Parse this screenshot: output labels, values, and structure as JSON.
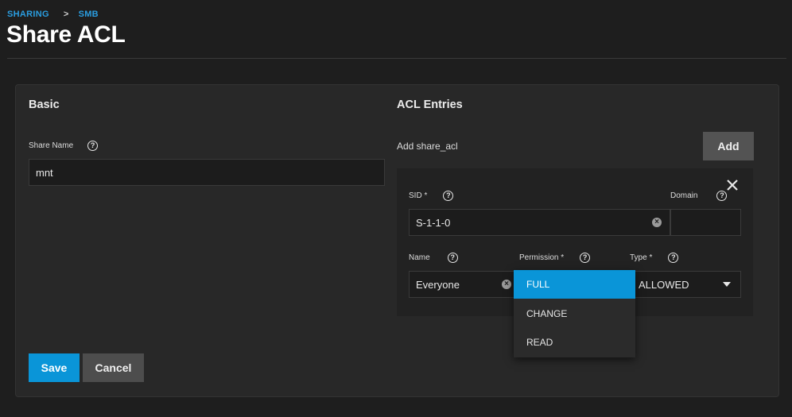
{
  "breadcrumb": {
    "item1": "SHARING",
    "sep": ">",
    "item2": "SMB"
  },
  "page": {
    "title": "Share ACL"
  },
  "basic": {
    "title": "Basic",
    "share_name_label": "Share Name",
    "share_name_value": "mnt"
  },
  "acl": {
    "title": "ACL Entries",
    "add_label": "Add share_acl",
    "add_button": "Add",
    "sid_label": "SID *",
    "sid_value": "S-1-1-0",
    "domain_label": "Domain",
    "domain_value": "",
    "name_label": "Name",
    "name_value": "Everyone",
    "permission_label": "Permission *",
    "type_label": "Type *",
    "type_value": "ALLOWED"
  },
  "permission_dropdown": {
    "options": [
      "FULL",
      "CHANGE",
      "READ"
    ],
    "selected": "FULL"
  },
  "actions": {
    "save": "Save",
    "cancel": "Cancel"
  },
  "icons": {
    "help": "?",
    "clear": "×",
    "close": "✕"
  },
  "colors": {
    "accent": "#0a95d8",
    "background": "#1e1e1e",
    "card": "#282828"
  }
}
